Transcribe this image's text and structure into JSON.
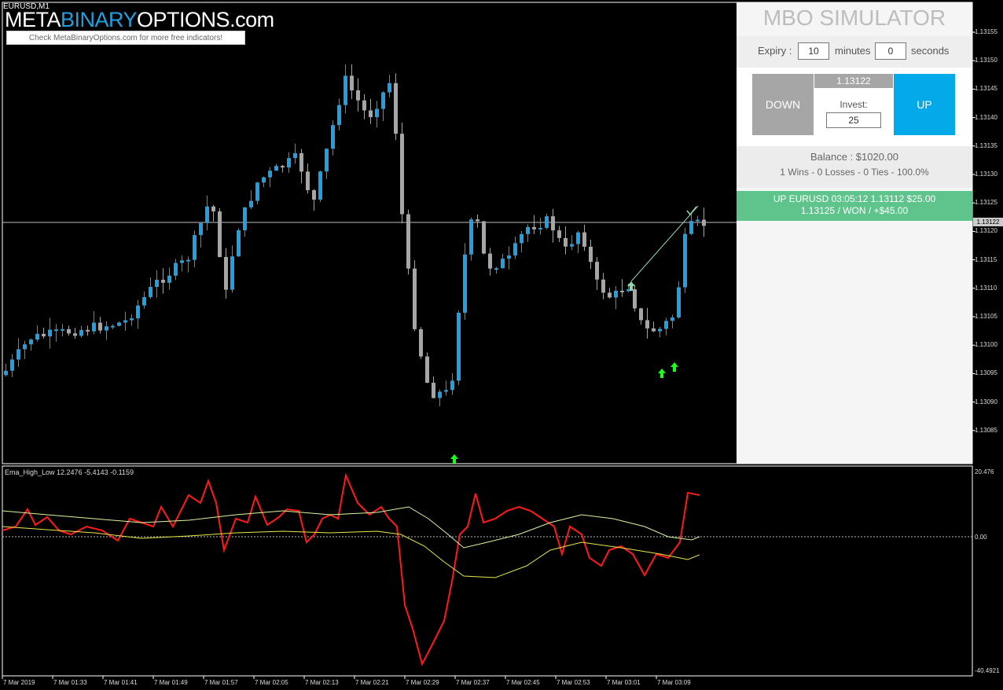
{
  "chart": {
    "symbol_tf": "EURUSD,M1",
    "brand": {
      "part1": "META",
      "part2": "BINARY",
      "part3": "OPTIONS",
      "part4": ".com"
    },
    "brand_link": "Check MetaBinaryOptions.com for more free indicators!",
    "current_price_label": "1.13122",
    "y_axis_labels": [
      "1.13155",
      "1.13150",
      "1.13145",
      "1.13140",
      "1.13135",
      "1.13130",
      "1.13125",
      "1.13120",
      "1.13115",
      "1.13110",
      "1.13105",
      "1.13100",
      "1.13095",
      "1.13090",
      "1.13085"
    ],
    "x_axis_labels": [
      "7 Mar 2019",
      "7 Mar 01:33",
      "7 Mar 01:41",
      "7 Mar 01:49",
      "7 Mar 01:57",
      "7 Mar 02:05",
      "7 Mar 02:13",
      "7 Mar 02:21",
      "7 Mar 02:29",
      "7 Mar 02:37",
      "7 Mar 02:45",
      "7 Mar 02:53",
      "7 Mar 03:01",
      "7 Mar 03:09"
    ],
    "colors": {
      "bull": "#1fa0e0",
      "bear": "#a6a6a6",
      "arrow": "#19ff19",
      "arrow_dim": "#8fd6a8",
      "grid": "#ffffff"
    }
  },
  "simulator": {
    "title": "MBO SIMULATOR",
    "expiry_label": "Expiry :",
    "minutes_value": "10",
    "minutes_label": "minutes",
    "seconds_value": "0",
    "seconds_label": "seconds",
    "down_label": "DOWN",
    "up_label": "UP",
    "price": "1.13122",
    "invest_label": "Invest:",
    "invest_value": "25",
    "balance": "Balance : $1020.00",
    "record": "1 Wins - 0 Losses - 0 Ties - 100.0%",
    "result_line1": "UP EURUSD 03:05:12 1.13112 $25.00",
    "result_line2": "1.13125 / WON / +$45.00",
    "colors": {
      "down": "#a6a6a6",
      "up": "#03a9e8",
      "result": "#5fc48c"
    }
  },
  "indicator": {
    "label": "Ema_High_Low 12.2476 -5.4143 -0.1159",
    "y_top": "20.476",
    "y_zero": "0.00",
    "y_bottom": "-40.4921",
    "colors": {
      "main": "#ff1a1a",
      "fast": "#d8f7a0",
      "slow": "#e8e84a"
    }
  }
}
